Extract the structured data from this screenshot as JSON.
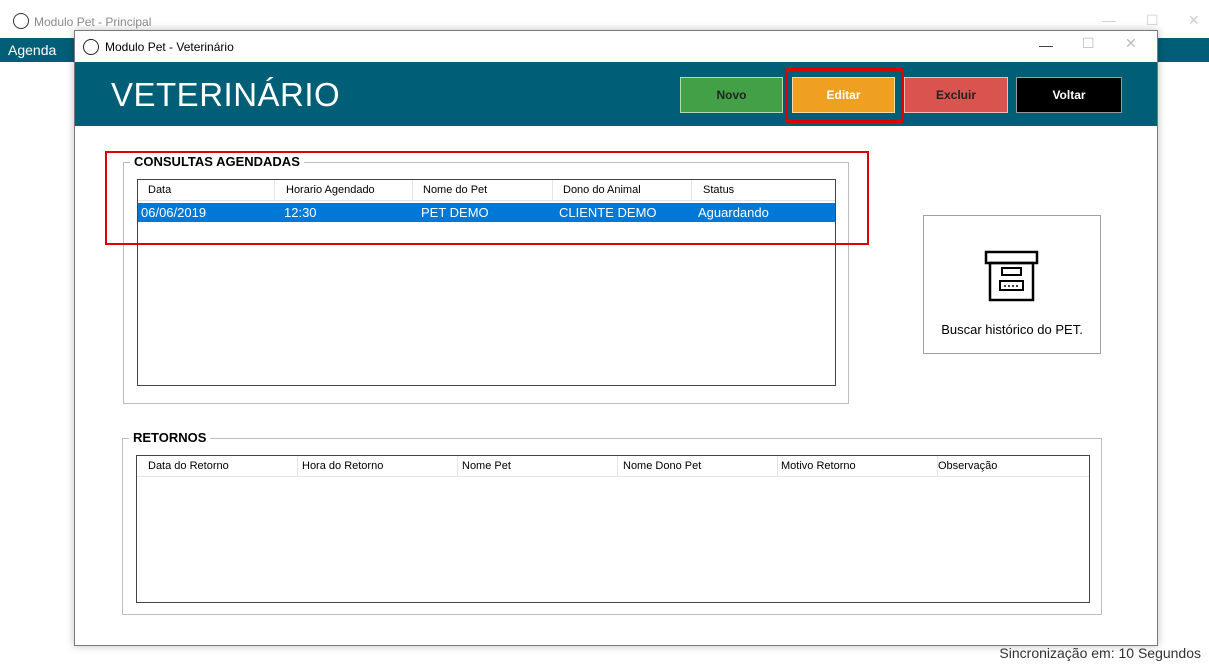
{
  "main_window": {
    "title": "Modulo Pet - Principal",
    "menu": {
      "agenda": "Agenda"
    },
    "sync_status": "Sincronização em: 10 Segundos"
  },
  "dialog": {
    "title": "Modulo Pet - Veterinário",
    "heading": "VETERINÁRIO",
    "buttons": {
      "novo": "Novo",
      "editar": "Editar",
      "excluir": "Excluir",
      "voltar": "Voltar"
    },
    "controls": {
      "minimize": "—",
      "maximize": "☐",
      "close": "✕"
    }
  },
  "consultas": {
    "title": "CONSULTAS AGENDADAS",
    "columns": [
      "Data",
      "Horario Agendado",
      "Nome do Pet",
      "Dono do Animal",
      "Status"
    ],
    "rows": [
      [
        "06/06/2019",
        "12:30",
        "PET DEMO",
        "CLIENTE DEMO",
        "Aguardando"
      ]
    ]
  },
  "retornos": {
    "title": "RETORNOS",
    "columns": [
      "Data do Retorno",
      "Hora do Retorno",
      "Nome Pet",
      "Nome Dono Pet",
      "Motivo Retorno",
      "Observação"
    ],
    "rows": []
  },
  "historico_button": {
    "label": "Buscar histórico do PET.",
    "icon": "archive-box-icon"
  },
  "colors": {
    "header": "#005e76",
    "novo": "#43a047",
    "editar": "#f0a020",
    "excluir": "#d9534f",
    "voltar": "#000000",
    "selected_row": "#0078d7",
    "highlight": "#e00000"
  }
}
